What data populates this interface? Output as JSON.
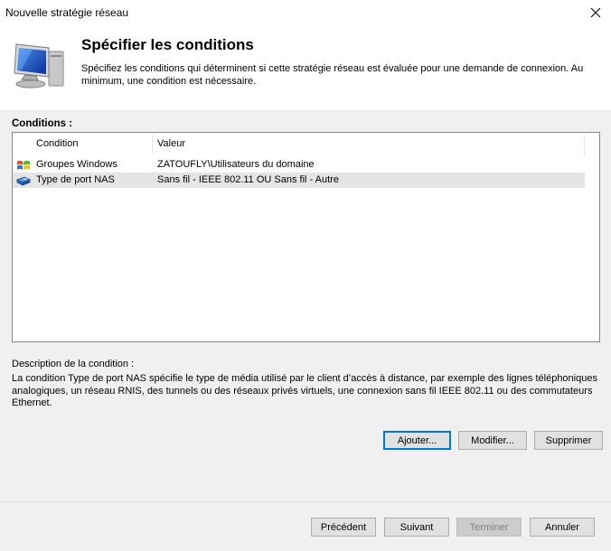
{
  "window": {
    "title": "Nouvelle stratégie réseau"
  },
  "header": {
    "title": "Spécifier les conditions",
    "description": "Spécifiez les conditions qui déterminent si cette stratégie réseau est évaluée pour une demande de connexion. Au minimum, une condition est nécessaire."
  },
  "conditions": {
    "label": "Conditions :",
    "columns": [
      "Condition",
      "Valeur"
    ],
    "rows": [
      {
        "icon": "windows-group-icon",
        "condition": "Groupes Windows",
        "value": "ZATOUFLY\\Utilisateurs du domaine",
        "selected": false
      },
      {
        "icon": "nas-port-icon",
        "condition": "Type de port NAS",
        "value": "Sans fil - IEEE 802.11 OU Sans fil - Autre",
        "selected": true
      }
    ]
  },
  "description": {
    "label": "Description de la condition :",
    "text": "La condition Type de port NAS spécifie le type de média utilisé par le client d’accès à distance, par exemple des lignes téléphoniques analogiques, un réseau RNIS, des tunnels ou des réseaux privés virtuels, une connexion sans fil IEEE 802.11 ou des commutateurs Ethernet."
  },
  "actions": {
    "add": "Ajouter...",
    "modify": "Modifier...",
    "delete": "Supprimer"
  },
  "footer": {
    "previous": "Précédent",
    "next": "Suivant",
    "finish": "Terminer",
    "cancel": "Annuler"
  }
}
